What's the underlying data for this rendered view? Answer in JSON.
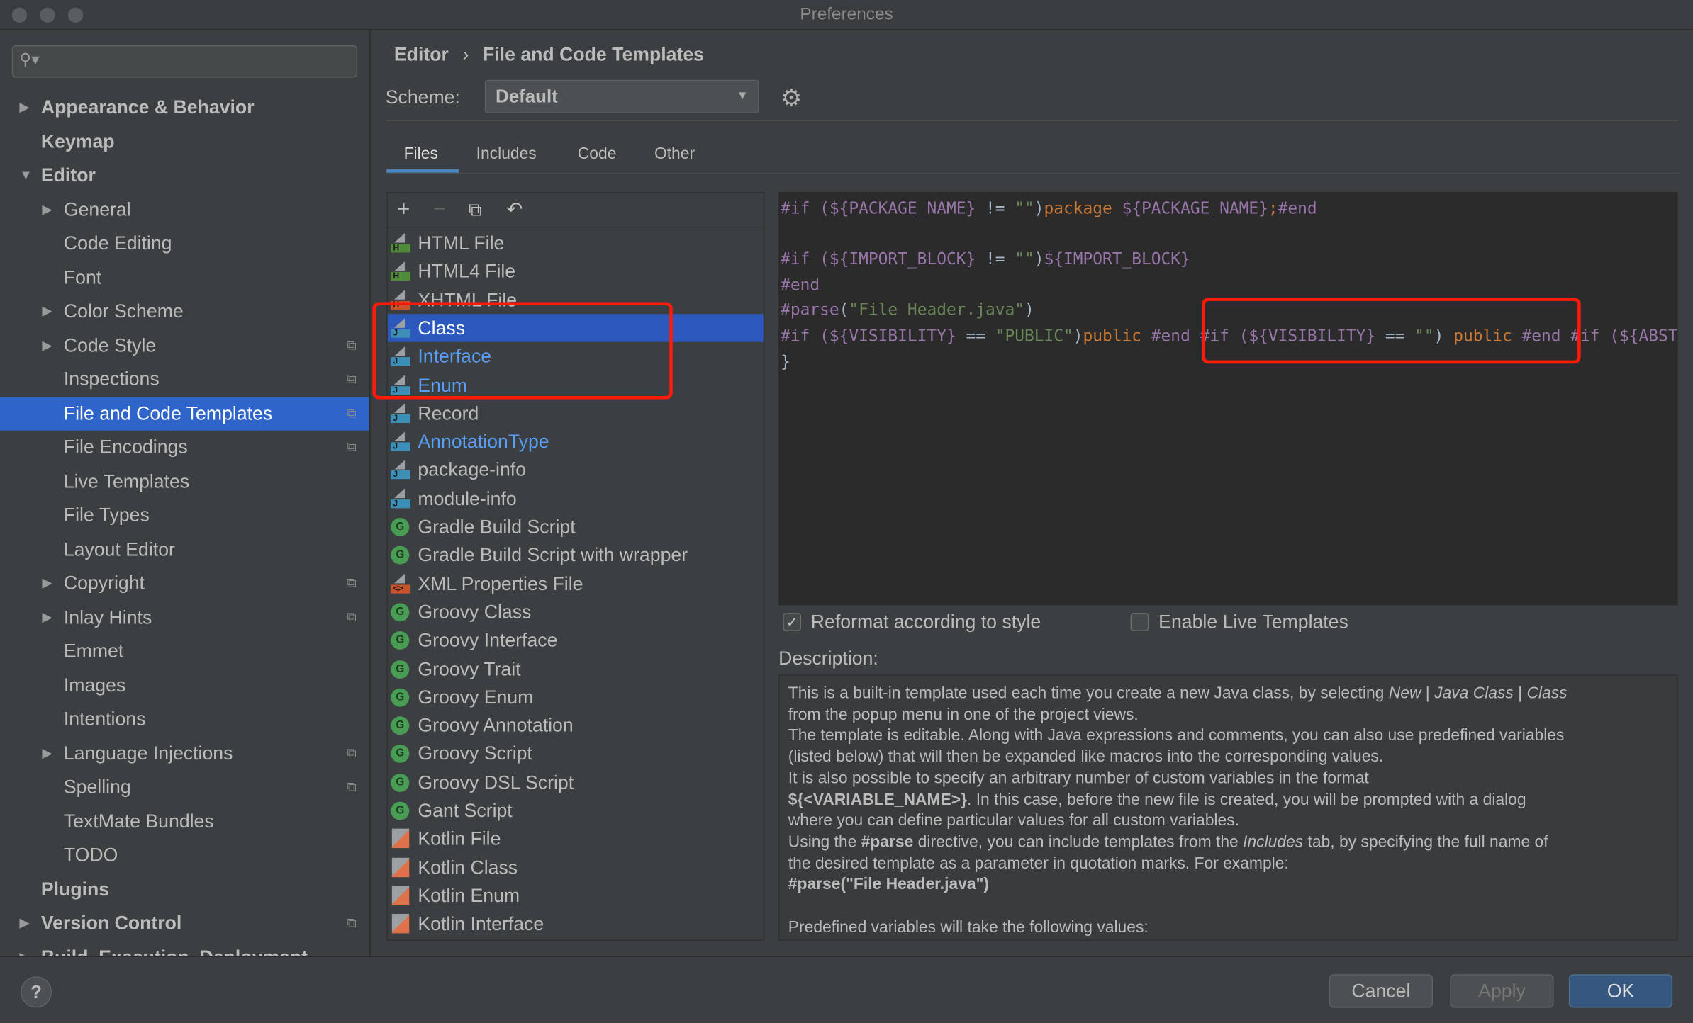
{
  "window": {
    "title": "Preferences"
  },
  "sidebar": {
    "search_placeholder": "",
    "items": [
      {
        "label": "Appearance & Behavior",
        "level": 0,
        "arrow": "right",
        "bold": true
      },
      {
        "label": "Keymap",
        "level": 0,
        "bold": true
      },
      {
        "label": "Editor",
        "level": 0,
        "arrow": "down",
        "bold": true
      },
      {
        "label": "General",
        "level": 1,
        "arrow": "right"
      },
      {
        "label": "Code Editing",
        "level": 1
      },
      {
        "label": "Font",
        "level": 1
      },
      {
        "label": "Color Scheme",
        "level": 1,
        "arrow": "right"
      },
      {
        "label": "Code Style",
        "level": 1,
        "arrow": "right",
        "project": true
      },
      {
        "label": "Inspections",
        "level": 1,
        "project": true
      },
      {
        "label": "File and Code Templates",
        "level": 1,
        "project": true,
        "selected": true
      },
      {
        "label": "File Encodings",
        "level": 1,
        "project": true
      },
      {
        "label": "Live Templates",
        "level": 1
      },
      {
        "label": "File Types",
        "level": 1
      },
      {
        "label": "Layout Editor",
        "level": 1
      },
      {
        "label": "Copyright",
        "level": 1,
        "arrow": "right",
        "project": true
      },
      {
        "label": "Inlay Hints",
        "level": 1,
        "arrow": "right",
        "project": true
      },
      {
        "label": "Emmet",
        "level": 1
      },
      {
        "label": "Images",
        "level": 1
      },
      {
        "label": "Intentions",
        "level": 1
      },
      {
        "label": "Language Injections",
        "level": 1,
        "arrow": "right",
        "project": true
      },
      {
        "label": "Spelling",
        "level": 1,
        "project": true
      },
      {
        "label": "TextMate Bundles",
        "level": 1
      },
      {
        "label": "TODO",
        "level": 1
      },
      {
        "label": "Plugins",
        "level": 0,
        "bold": true
      },
      {
        "label": "Version Control",
        "level": 0,
        "arrow": "right",
        "bold": true,
        "project": true
      },
      {
        "label": "Build, Execution, Deployment",
        "level": 0,
        "arrow": "right",
        "bold": true
      }
    ]
  },
  "breadcrumb": {
    "parent": "Editor",
    "sep": "›",
    "current": "File and Code Templates"
  },
  "scheme": {
    "label": "Scheme:",
    "value": "Default"
  },
  "tabs": [
    {
      "label": "Files",
      "active": true
    },
    {
      "label": "Includes"
    },
    {
      "label": "Code"
    },
    {
      "label": "Other"
    }
  ],
  "templates": [
    {
      "label": "HTML File",
      "icon": "html",
      "color": "normal"
    },
    {
      "label": "HTML4 File",
      "icon": "html",
      "color": "normal"
    },
    {
      "label": "XHTML File",
      "icon": "xhtml",
      "color": "normal"
    },
    {
      "label": "Class",
      "icon": "java",
      "selected": true
    },
    {
      "label": "Interface",
      "icon": "java",
      "color": "blue"
    },
    {
      "label": "Enum",
      "icon": "java",
      "color": "blue"
    },
    {
      "label": "Record",
      "icon": "java",
      "color": "normal"
    },
    {
      "label": "AnnotationType",
      "icon": "java",
      "color": "blue"
    },
    {
      "label": "package-info",
      "icon": "java",
      "color": "normal"
    },
    {
      "label": "module-info",
      "icon": "java",
      "color": "normal"
    },
    {
      "label": "Gradle Build Script",
      "icon": "gradle",
      "color": "normal"
    },
    {
      "label": "Gradle Build Script with wrapper",
      "icon": "gradle",
      "color": "normal"
    },
    {
      "label": "XML Properties File",
      "icon": "xml",
      "color": "normal"
    },
    {
      "label": "Groovy Class",
      "icon": "groovy",
      "color": "normal"
    },
    {
      "label": "Groovy Interface",
      "icon": "groovy",
      "color": "normal"
    },
    {
      "label": "Groovy Trait",
      "icon": "groovy",
      "color": "normal"
    },
    {
      "label": "Groovy Enum",
      "icon": "groovy",
      "color": "normal"
    },
    {
      "label": "Groovy Annotation",
      "icon": "groovy",
      "color": "normal"
    },
    {
      "label": "Groovy Script",
      "icon": "groovy",
      "color": "normal"
    },
    {
      "label": "Groovy DSL Script",
      "icon": "groovy",
      "color": "normal"
    },
    {
      "label": "Gant Script",
      "icon": "groovy",
      "color": "normal"
    },
    {
      "label": "Kotlin File",
      "icon": "kotlin",
      "color": "normal"
    },
    {
      "label": "Kotlin Class",
      "icon": "kotlin",
      "color": "normal"
    },
    {
      "label": "Kotlin Enum",
      "icon": "kotlin",
      "color": "normal"
    },
    {
      "label": "Kotlin Interface",
      "icon": "kotlin",
      "color": "normal"
    }
  ],
  "editor": {
    "lines": [
      [
        [
          "p",
          "#if ("
        ],
        [
          "p",
          "${PACKAGE_NAME}"
        ],
        [
          "n",
          " != "
        ],
        [
          "g",
          "\"\""
        ],
        [
          "n",
          ")"
        ],
        [
          "o",
          "package "
        ],
        [
          "p",
          "${PACKAGE_NAME}"
        ],
        [
          "o",
          ";"
        ],
        [
          "p",
          "#end"
        ]
      ],
      [],
      [
        [
          "p",
          "#if ("
        ],
        [
          "p",
          "${IMPORT_BLOCK}"
        ],
        [
          "n",
          " != "
        ],
        [
          "g",
          "\"\""
        ],
        [
          "n",
          ")"
        ],
        [
          "p",
          "${IMPORT_BLOCK}"
        ]
      ],
      [
        [
          "p",
          "#end"
        ]
      ],
      [
        [
          "p",
          "#parse"
        ],
        [
          "n",
          "("
        ],
        [
          "g",
          "\"File Header.java\""
        ],
        [
          "n",
          ")"
        ]
      ],
      [
        [
          "p",
          "#if ("
        ],
        [
          "p",
          "${VISIBILITY}"
        ],
        [
          "n",
          " == "
        ],
        [
          "g",
          "\"PUBLIC\""
        ],
        [
          "n",
          ")"
        ],
        [
          "o",
          "public "
        ],
        [
          "p",
          "#end "
        ],
        [
          "p",
          "#if ("
        ],
        [
          "p",
          "${VISIBILITY}"
        ],
        [
          "n",
          " == "
        ],
        [
          "g",
          "\"\""
        ],
        [
          "n",
          ") "
        ],
        [
          "o",
          "public "
        ],
        [
          "p",
          "#end "
        ],
        [
          "p",
          "#if ("
        ],
        [
          "p",
          "${ABSTRACT}"
        ]
      ],
      [
        [
          "n",
          "}"
        ]
      ]
    ]
  },
  "options": {
    "reformat": {
      "label": "Reformat according to style",
      "checked": true
    },
    "live_templates": {
      "label": "Enable Live Templates",
      "checked": false
    }
  },
  "description": {
    "label": "Description:",
    "html": "This is a built-in template used each time you create a new Java class, by selecting <i>New</i> | <i>Java Class</i> | <i>Class</i><br>from the popup menu in one of the project views.<br>The template is editable. Along with Java expressions and comments, you can also use predefined variables<br>(listed below) that will then be expanded like macros into the corresponding values.<br>It is also possible to specify an arbitrary number of custom variables in the format<br><b>${&lt;VARIABLE_NAME&gt;}</b>. In this case, before the new file is created, you will be prompted with a dialog<br>where you can define particular values for all custom variables.<br>Using the <b>#parse</b> directive, you can include templates from the <i>Includes</i> tab, by specifying the full name of<br>the desired template as a parameter in quotation marks. For example:<br><b>#parse(\"File Header.java\")</b><br><br>Predefined variables will take the following values:"
  },
  "footer": {
    "help": "?",
    "cancel": "Cancel",
    "apply": "Apply",
    "ok": "OK"
  },
  "colors": {
    "selection": "#2f65ca",
    "accent": "#4a88c7",
    "highlight_box": "#ff1a0a",
    "keyword": "#cc7832",
    "variable": "#9876aa",
    "string": "#6a8759"
  }
}
